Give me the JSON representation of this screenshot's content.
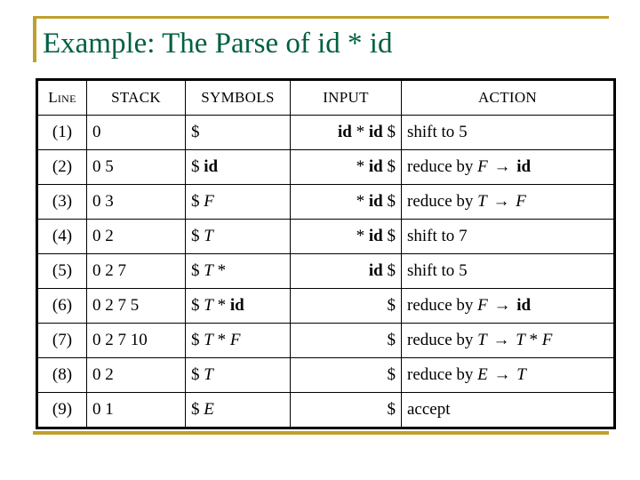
{
  "slide": {
    "title": "Example: The Parse of id * id",
    "title_color": "#006040",
    "accent_color": "#C0A02C",
    "background": "#ffffff"
  },
  "table": {
    "name": "parse-trace-table",
    "headers": {
      "line": "Line",
      "stack": "STACK",
      "symbols": "SYMBOLS",
      "input": "INPUT",
      "action": "ACTION"
    },
    "rows": [
      {
        "line": "(1)",
        "stack": "0",
        "symbols": "$",
        "input": "id * id $",
        "action": "shift to 5"
      },
      {
        "line": "(2)",
        "stack": "0 5",
        "symbols": "$ id",
        "input": "* id $",
        "action": "reduce by F → id"
      },
      {
        "line": "(3)",
        "stack": "0 3",
        "symbols": "$ F",
        "input": "* id $",
        "action": "reduce by T → F"
      },
      {
        "line": "(4)",
        "stack": "0 2",
        "symbols": "$ T",
        "input": "* id $",
        "action": "shift to 7"
      },
      {
        "line": "(5)",
        "stack": "0 2 7",
        "symbols": "$ T *",
        "input": "id $",
        "action": "shift to 5"
      },
      {
        "line": "(6)",
        "stack": "0 2 7 5",
        "symbols": "$ T * id",
        "input": "$",
        "action": "reduce by F → id"
      },
      {
        "line": "(7)",
        "stack": "0 2 7 10",
        "symbols": "$ T * F",
        "input": "$",
        "action": "reduce by T → T * F"
      },
      {
        "line": "(8)",
        "stack": "0 2",
        "symbols": "$ T",
        "input": "$",
        "action": "reduce by E → T"
      },
      {
        "line": "(9)",
        "stack": "0 1",
        "symbols": "$ E",
        "input": "$",
        "action": "accept"
      }
    ]
  },
  "typography": {
    "terminals": [
      "id"
    ],
    "nonterminals": [
      "E",
      "T",
      "F"
    ],
    "plain_tokens": [
      "$",
      "*",
      "→"
    ]
  }
}
